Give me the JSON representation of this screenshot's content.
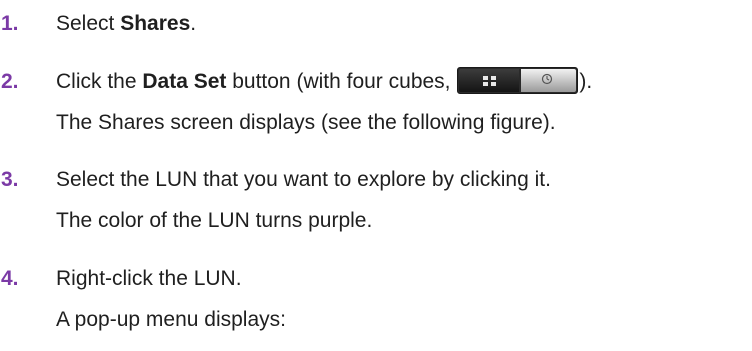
{
  "steps": [
    {
      "number": "1.",
      "text_before": "Select ",
      "bold": "Shares",
      "text_after": "."
    },
    {
      "number": "2.",
      "text_before": "Click the ",
      "bold": "Data Set",
      "text_middle": " button (with four cubes, ",
      "text_after": ").",
      "icon": "data-set-toggle-button-icon",
      "note": "The Shares screen displays (see the following figure)."
    },
    {
      "number": "3.",
      "text": "Select the LUN that you want to explore by clicking it.",
      "note": "The color of the LUN turns purple."
    },
    {
      "number": "4.",
      "text": "Right-click the LUN.",
      "note": "A pop-up menu displays:"
    }
  ],
  "colors": {
    "step_number": "#7b3aa6",
    "body_text": "#1f1f1f"
  }
}
